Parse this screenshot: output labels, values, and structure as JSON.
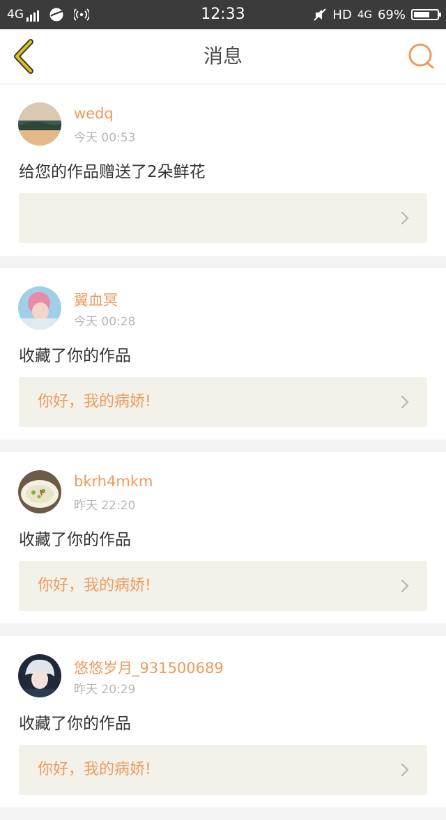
{
  "status_bar": {
    "network": "4G",
    "time": "12:33",
    "hd": "HD",
    "net2": "4G",
    "battery": "69%",
    "battery_level": 0.69
  },
  "header": {
    "title": "消息",
    "back_icon": "chevron-left-icon",
    "search_icon": "search-icon"
  },
  "colors": {
    "accent": "#ee9a5c",
    "back_arrow": "#d9c31a",
    "box_bg": "#f3f2ea"
  },
  "messages": [
    {
      "username": "wedq",
      "time": "今天 00:53",
      "action": "给您的作品赠送了2朵鲜花",
      "work_title": ""
    },
    {
      "username": "翼血冥",
      "time": "今天 00:28",
      "action": "收藏了你的作品",
      "work_title": "你好，我的病娇!"
    },
    {
      "username": "bkrh4mkm",
      "time": "昨天 22:20",
      "action": "收藏了你的作品",
      "work_title": "你好，我的病娇!"
    },
    {
      "username": "悠悠岁月_931500689",
      "time": "昨天 20:29",
      "action": "收藏了你的作品",
      "work_title": "你好，我的病娇!"
    }
  ]
}
